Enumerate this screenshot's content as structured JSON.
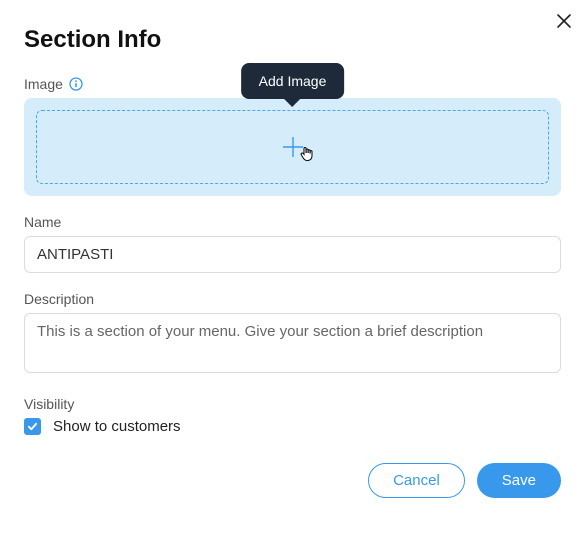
{
  "header": {
    "title": "Section Info"
  },
  "image": {
    "label": "Image",
    "tooltip": "Add Image"
  },
  "name": {
    "label": "Name",
    "value": "ANTIPASTI"
  },
  "description": {
    "label": "Description",
    "value": "This is a section of your menu. Give your section a brief description"
  },
  "visibility": {
    "label": "Visibility",
    "checkbox_label": "Show to customers",
    "checked": true
  },
  "actions": {
    "cancel": "Cancel",
    "save": "Save"
  },
  "colors": {
    "accent": "#3899ec",
    "image_bg": "#d5ecfb",
    "tooltip_bg": "#1e2a3a"
  }
}
